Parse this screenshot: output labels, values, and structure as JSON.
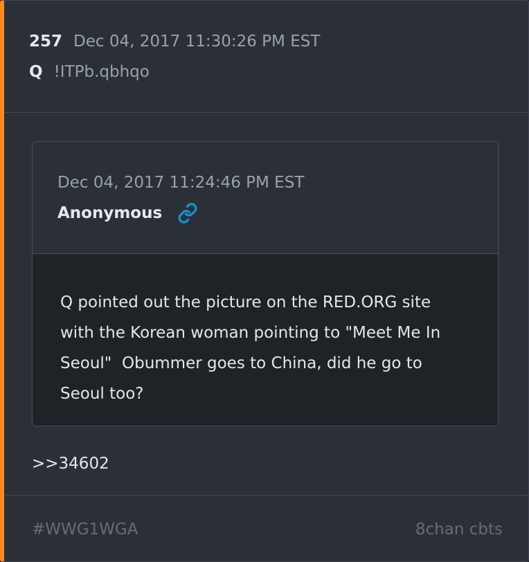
{
  "post": {
    "number": "257",
    "timestamp": "Dec 04, 2017 11:30:26 PM EST",
    "author": "Q",
    "tripcode": "!ITPb.qbhqo"
  },
  "quoted_post": {
    "timestamp": "Dec 04, 2017 11:24:46 PM EST",
    "author": "Anonymous",
    "link_icon": "link-icon",
    "text": "Q pointed out the picture on the RED.ORG site\nwith the Korean woman pointing to \"Meet Me In\nSeoul\"  Obummer goes to China, did he go to\nSeoul too?"
  },
  "reply_reference": ">>34602",
  "footer": {
    "hashtag": "#WWG1WGA",
    "source": "8chan cbts"
  },
  "colors": {
    "accent": "#ff8a1f",
    "link_icon": "#1a8fd6",
    "background": "#2b3038",
    "quote_body": "#1f2227"
  }
}
